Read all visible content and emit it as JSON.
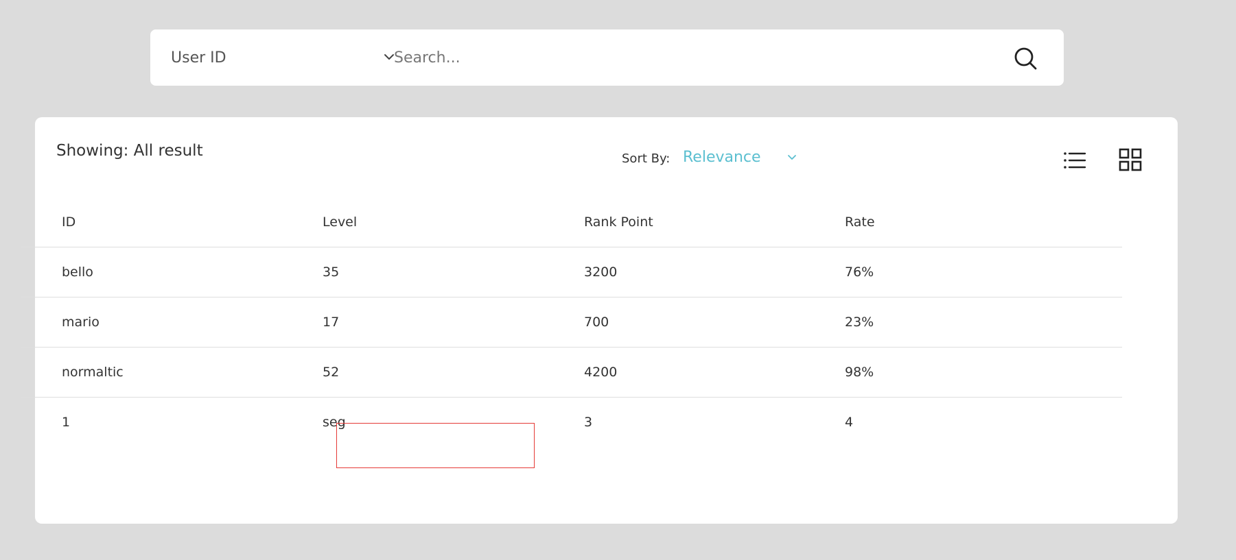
{
  "search": {
    "field_select_label": "User ID",
    "placeholder": "Search..."
  },
  "results": {
    "showing_text": "Showing: All result",
    "sort_label": "Sort By:",
    "sort_value": "Relevance",
    "accent_color": "#5bbfd0",
    "view_icons": [
      "list-view-icon",
      "grid-view-icon"
    ]
  },
  "table": {
    "columns": [
      "ID",
      "Level",
      "Rank Point",
      "Rate"
    ],
    "rows": [
      [
        "bello",
        "35",
        "3200",
        "76%"
      ],
      [
        "mario",
        "17",
        "700",
        "23%"
      ],
      [
        "normaltic",
        "52",
        "4200",
        "98%"
      ],
      [
        "1",
        "seg\t",
        "3",
        "4"
      ]
    ]
  },
  "highlight_color": "#e53935"
}
